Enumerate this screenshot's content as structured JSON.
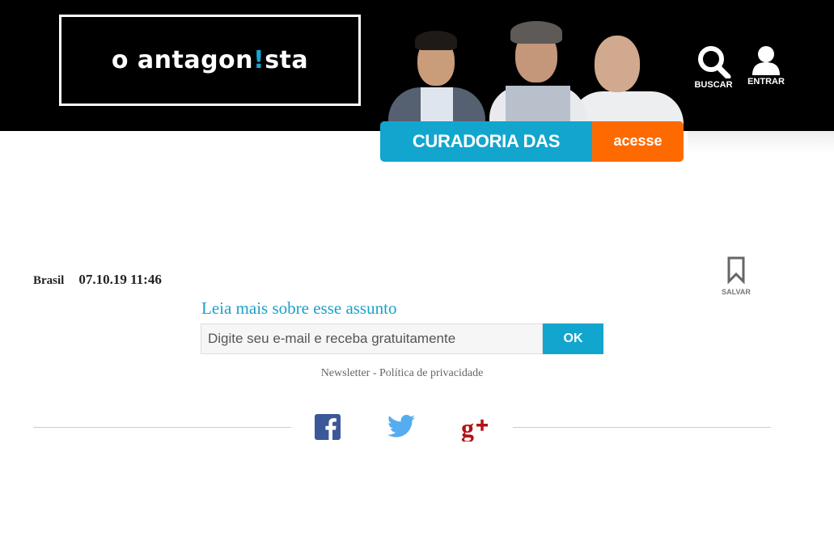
{
  "header": {
    "logo_text_before": "o antagon",
    "logo_text_bang": "!",
    "logo_text_after": "sta",
    "search_label": "BUSCAR",
    "login_label": "ENTRAR",
    "promo_label": "CURADORIA DAS REDES",
    "promo_cta": "acesse",
    "colors": {
      "background": "#000000",
      "accent": "#12a6cf",
      "cta": "#ff6a00"
    }
  },
  "article": {
    "category": "Brasil",
    "date": "07.10.19 11:46",
    "save_label": "SALVAR"
  },
  "newsletter": {
    "title": "Leia mais sobre esse assunto",
    "email_placeholder": "Digite seu e-mail e receba gratuitamente",
    "submit_label": "OK",
    "link_newsletter": "Newsletter",
    "separator": " - ",
    "link_privacy": "Política de privacidade"
  },
  "share": {
    "icons": [
      "facebook-icon",
      "twitter-icon",
      "google-plus-icon"
    ],
    "colors": {
      "facebook": "#3b5998",
      "twitter": "#55acee",
      "google_plus": "#b31217"
    }
  }
}
